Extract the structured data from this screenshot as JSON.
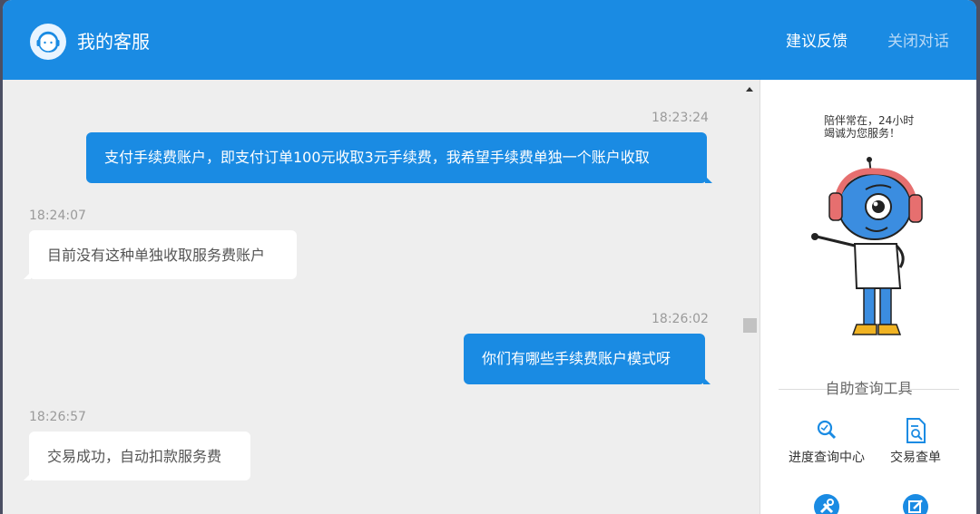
{
  "header": {
    "title": "我的客服",
    "feedback": "建议反馈",
    "close": "关闭对话"
  },
  "messages": [
    {
      "time": "18:23:24",
      "side": "out",
      "text": "支付手续费账户，即支付订单100元收取3元手续费，我希望手续费单独一个账户收取"
    },
    {
      "time": "18:24:07",
      "side": "in",
      "text": "目前没有这种单独收取服务费账户"
    },
    {
      "time": "18:26:02",
      "side": "out",
      "text": "你们有哪些手续费账户模式呀"
    },
    {
      "time": "18:26:57",
      "side": "in",
      "text": "交易成功，自动扣款服务费"
    }
  ],
  "sidebar": {
    "slogan_line1": "陪伴常在，24小时",
    "slogan_line2": "竭诚为您服务！",
    "tools_title": "自助查询工具",
    "tools": [
      {
        "label": "进度查询中心",
        "icon": "search-progress-icon"
      },
      {
        "label": "交易查单",
        "icon": "document-search-icon"
      },
      {
        "label": "",
        "icon": "tools-icon"
      },
      {
        "label": "",
        "icon": "edit-icon"
      }
    ]
  },
  "colors": {
    "brand": "#1a8be3",
    "chat_bg": "#eeeeee",
    "bubble_in": "#ffffff"
  }
}
